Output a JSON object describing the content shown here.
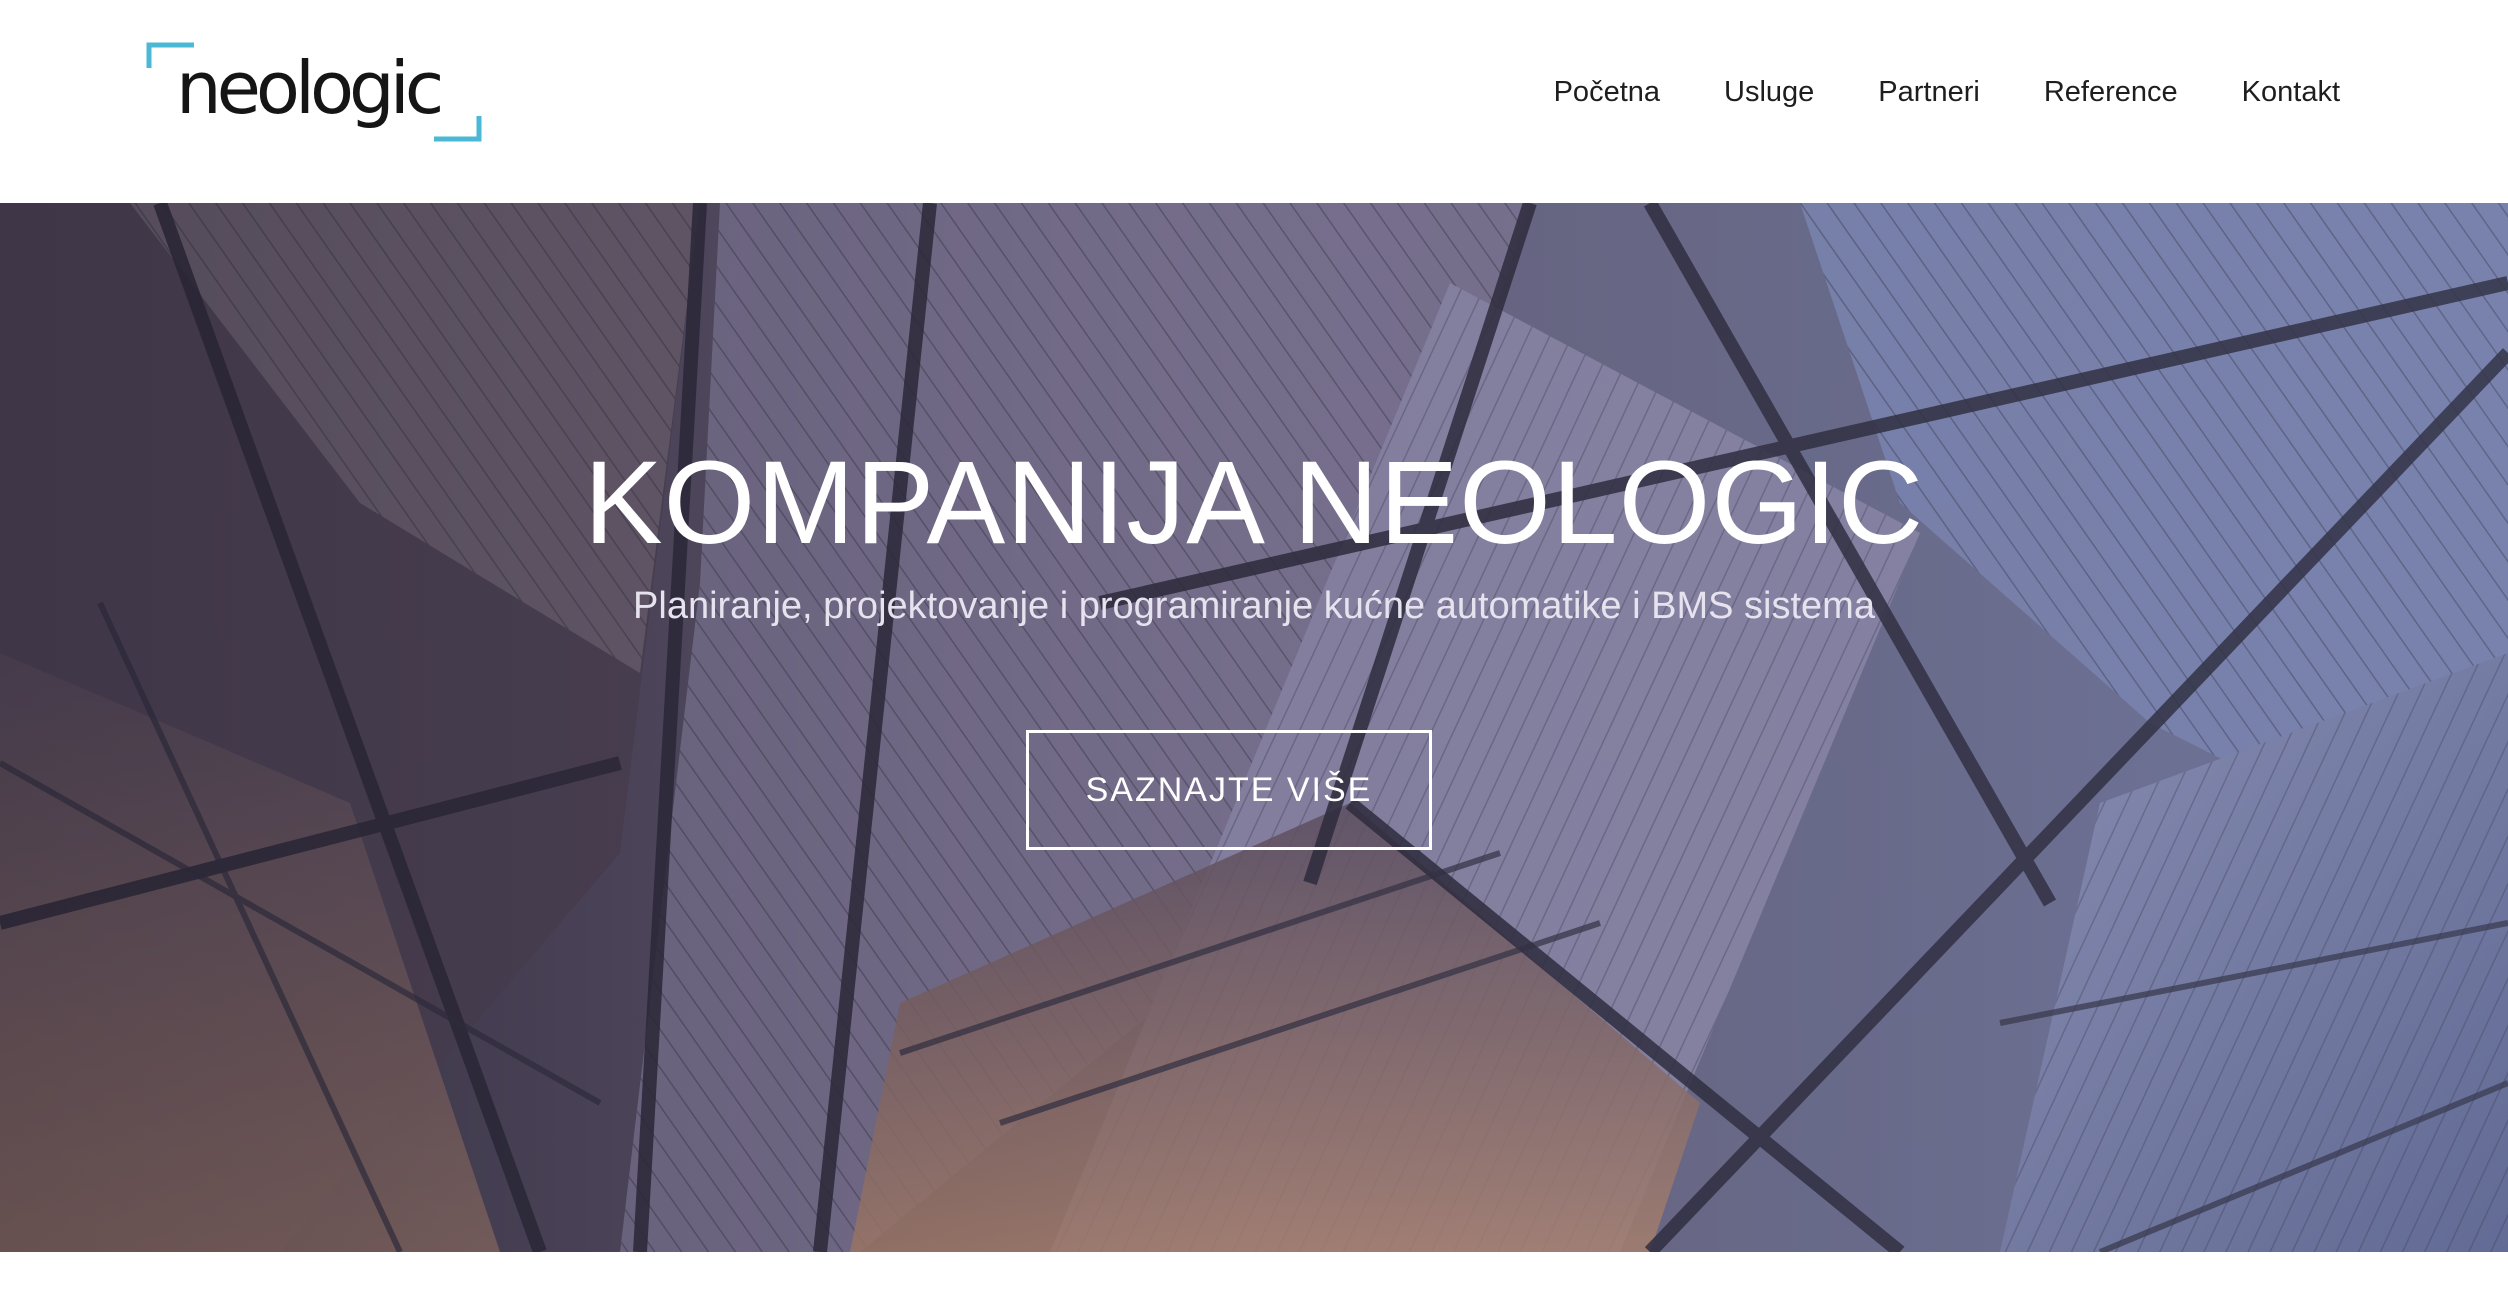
{
  "logo": {
    "text": "neologic",
    "accent_color": "#4bb8d6"
  },
  "nav": {
    "items": [
      {
        "label": "Početna"
      },
      {
        "label": "Usluge"
      },
      {
        "label": "Partneri"
      },
      {
        "label": "Reference"
      },
      {
        "label": "Kontakt"
      }
    ]
  },
  "hero": {
    "title": "KOMPANIJA NEOLOGIC",
    "subtitle": "Planiranje, projektovanje i programiranje kućne automatike i BMS sistema",
    "button_label": "SAZNAJTE VIŠE"
  },
  "colors": {
    "text_dark": "#1e1e1e",
    "hero_text": "#ffffff"
  }
}
